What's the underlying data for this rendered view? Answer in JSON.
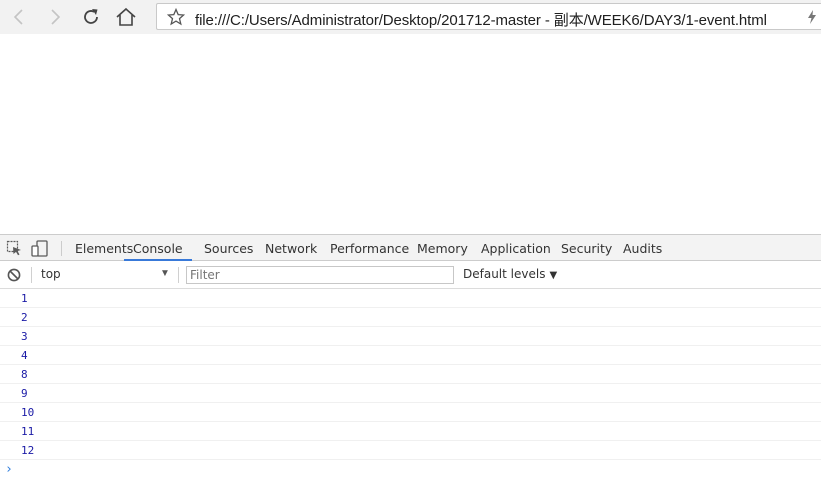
{
  "browser": {
    "url": "file:///C:/Users/Administrator/Desktop/201712-master - 副本/WEEK6/DAY3/1-event.html",
    "icons": [
      "back-icon",
      "forward-icon",
      "reload-icon",
      "home-icon",
      "star-icon",
      "bolt-icon"
    ]
  },
  "devtools": {
    "tabs": [
      {
        "label": "Elements"
      },
      {
        "label": "Console"
      },
      {
        "label": "Sources"
      },
      {
        "label": "Network"
      },
      {
        "label": "Performance"
      },
      {
        "label": "Memory"
      },
      {
        "label": "Application"
      },
      {
        "label": "Security"
      },
      {
        "label": "Audits"
      }
    ],
    "active_tab": "Console",
    "filter_bar": {
      "context": "top",
      "filter_placeholder": "Filter",
      "levels": "Default levels"
    },
    "console_lines": [
      "1",
      "2",
      "3",
      "4",
      "8",
      "9",
      "10",
      "11",
      "12"
    ],
    "prompt": "›",
    "accent_color": "#3879d9",
    "log_color": "#1a1aa6"
  }
}
